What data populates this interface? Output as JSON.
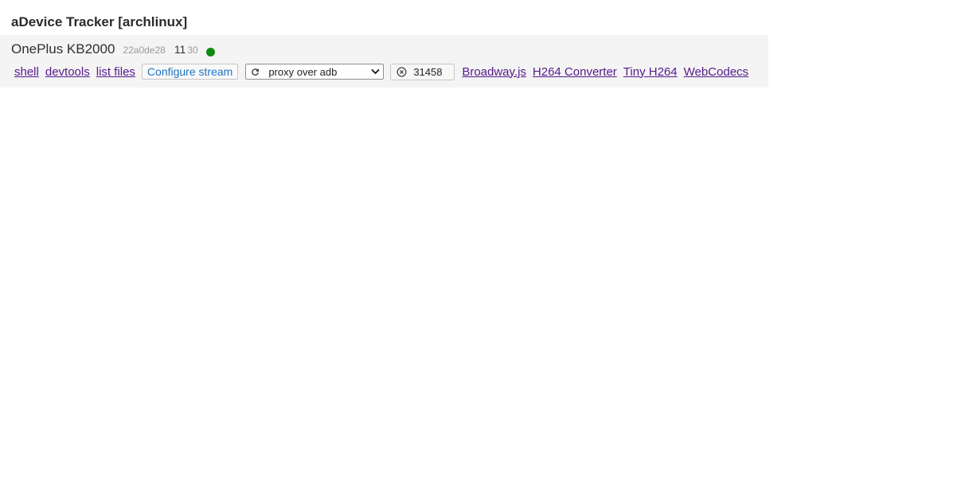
{
  "tracker": {
    "title": "aDevice Tracker [archlinux]"
  },
  "device": {
    "name": "OnePlus KB2000",
    "serial": "22a0de28",
    "release": "11",
    "sdk": "30",
    "status_color": "#0f8a0f"
  },
  "actions": {
    "shell": "shell",
    "devtools": "devtools",
    "list_files": "list files",
    "configure_stream": "Configure stream"
  },
  "interface_select": {
    "selected": "proxy over adb",
    "refresh_icon": "refresh-icon",
    "chevron_icon": "chevron-down-icon"
  },
  "port": {
    "value": "31458",
    "icon": "close-circle-icon"
  },
  "players": {
    "broadway": "Broadway.js",
    "h264_converter": "H264 Converter",
    "tiny_h264": "Tiny H264",
    "webcodecs": "WebCodecs"
  },
  "colors": {
    "link": "#551a8b",
    "accent": "#1f73c4",
    "panel_bg": "#f4f4f4"
  }
}
